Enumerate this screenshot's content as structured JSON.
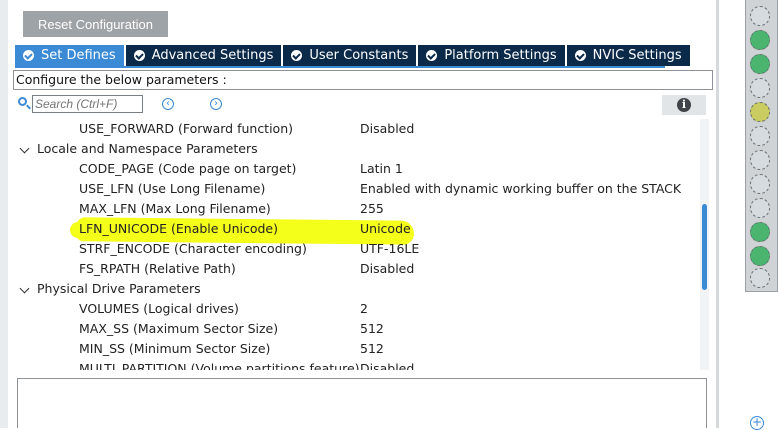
{
  "toolbar": {
    "reset_label": "Reset Configuration"
  },
  "tabs": [
    {
      "label": "Set Defines",
      "active": true
    },
    {
      "label": "Advanced Settings",
      "active": false
    },
    {
      "label": "User Constants",
      "active": false
    },
    {
      "label": "Platform Settings",
      "active": false
    },
    {
      "label": "NVIC Settings",
      "active": false
    }
  ],
  "hint": "Configure the below parameters :",
  "search": {
    "placeholder": "Search (Ctrl+F)"
  },
  "rows": [
    {
      "type": "param",
      "name": "USE_FORWARD (Forward function)",
      "value": "Disabled"
    },
    {
      "type": "group",
      "name": "Locale and Namespace Parameters"
    },
    {
      "type": "param",
      "name": "CODE_PAGE (Code page on target)",
      "value": "Latin 1"
    },
    {
      "type": "param",
      "name": "USE_LFN (Use Long Filename)",
      "value": "Enabled with dynamic working buffer on the STACK"
    },
    {
      "type": "param",
      "name": "MAX_LFN (Max Long Filename)",
      "value": "255"
    },
    {
      "type": "param",
      "name": "LFN_UNICODE (Enable Unicode)",
      "value": "Unicode",
      "highlighted": true
    },
    {
      "type": "param",
      "name": "STRF_ENCODE (Character encoding)",
      "value": "UTF-16LE"
    },
    {
      "type": "param",
      "name": "FS_RPATH (Relative Path)",
      "value": "Disabled"
    },
    {
      "type": "group",
      "name": "Physical Drive Parameters"
    },
    {
      "type": "param",
      "name": "VOLUMES (Logical drives)",
      "value": "2"
    },
    {
      "type": "param",
      "name": "MAX_SS (Maximum Sector Size)",
      "value": "512"
    },
    {
      "type": "param",
      "name": "MIN_SS (Minimum Sector Size)",
      "value": "512"
    },
    {
      "type": "param",
      "name": "MULTI_PARTITION (Volume partitions feature)",
      "value": "Disabled"
    }
  ],
  "colors": {
    "accent": "#3a8ad6",
    "tab_bg": "#0b2a4a",
    "highlight": "#f4ff1a"
  }
}
